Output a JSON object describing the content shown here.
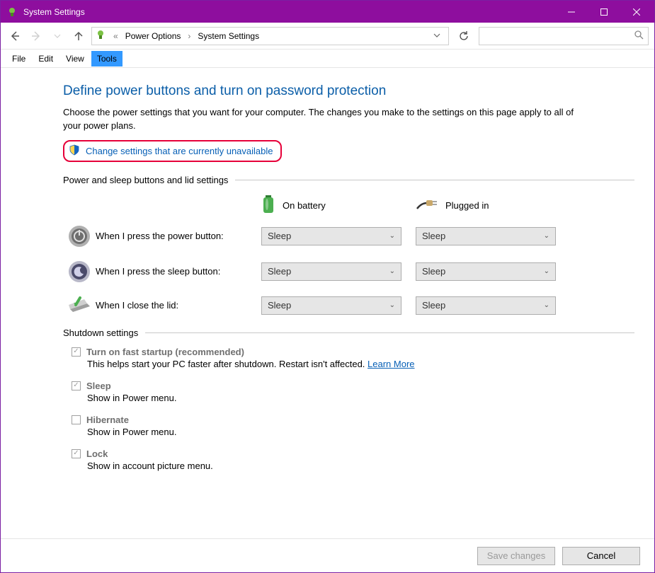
{
  "window": {
    "title": "System Settings"
  },
  "breadcrumb": {
    "ellipsis": "«",
    "seg1": "Power Options",
    "seg2": "System Settings"
  },
  "menu": {
    "file": "File",
    "edit": "Edit",
    "view": "View",
    "tools": "Tools"
  },
  "page": {
    "heading": "Define power buttons and turn on password protection",
    "description": "Choose the power settings that you want for your computer. The changes you make to the settings on this page apply to all of your power plans.",
    "change_link": "Change settings that are currently unavailable"
  },
  "button_settings": {
    "section_label": "Power and sleep buttons and lid settings",
    "col_battery": "On battery",
    "col_plugged": "Plugged in",
    "rows": [
      {
        "label": "When I press the power button:",
        "battery": "Sleep",
        "plugged": "Sleep"
      },
      {
        "label": "When I press the sleep button:",
        "battery": "Sleep",
        "plugged": "Sleep"
      },
      {
        "label": "When I close the lid:",
        "battery": "Sleep",
        "plugged": "Sleep"
      }
    ]
  },
  "shutdown": {
    "section_label": "Shutdown settings",
    "items": [
      {
        "title": "Turn on fast startup (recommended)",
        "desc": "This helps start your PC faster after shutdown. Restart isn't affected. ",
        "learn": "Learn More",
        "checked": true
      },
      {
        "title": "Sleep",
        "desc": "Show in Power menu.",
        "checked": true
      },
      {
        "title": "Hibernate",
        "desc": "Show in Power menu.",
        "checked": false
      },
      {
        "title": "Lock",
        "desc": "Show in account picture menu.",
        "checked": true
      }
    ]
  },
  "footer": {
    "save": "Save changes",
    "cancel": "Cancel"
  }
}
